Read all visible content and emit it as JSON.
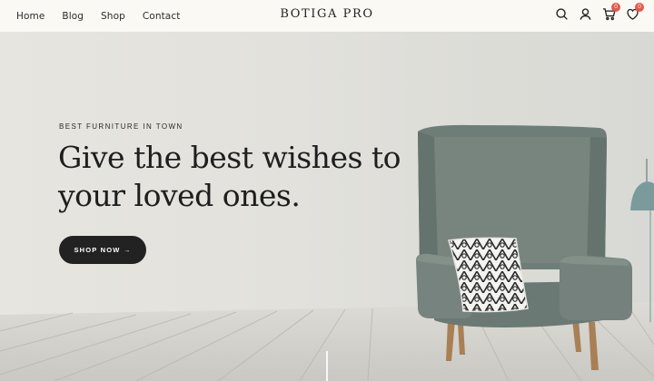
{
  "header": {
    "nav": [
      "Home",
      "Blog",
      "Shop",
      "Contact"
    ],
    "brand": "BOTIGA PRO",
    "icons": [
      {
        "name": "search-icon"
      },
      {
        "name": "user-icon"
      },
      {
        "name": "cart-icon",
        "badge": "0"
      },
      {
        "name": "wishlist-icon",
        "badge": "0"
      }
    ],
    "badge_color": "#e8564c"
  },
  "hero": {
    "eyebrow": "BEST FURNITURE IN TOWN",
    "headline": "Give the best wishes to your loved ones.",
    "cta_label": "SHOP NOW →",
    "cta_color": "#222222",
    "image": "armchair-with-pillow-on-wooden-floor"
  }
}
